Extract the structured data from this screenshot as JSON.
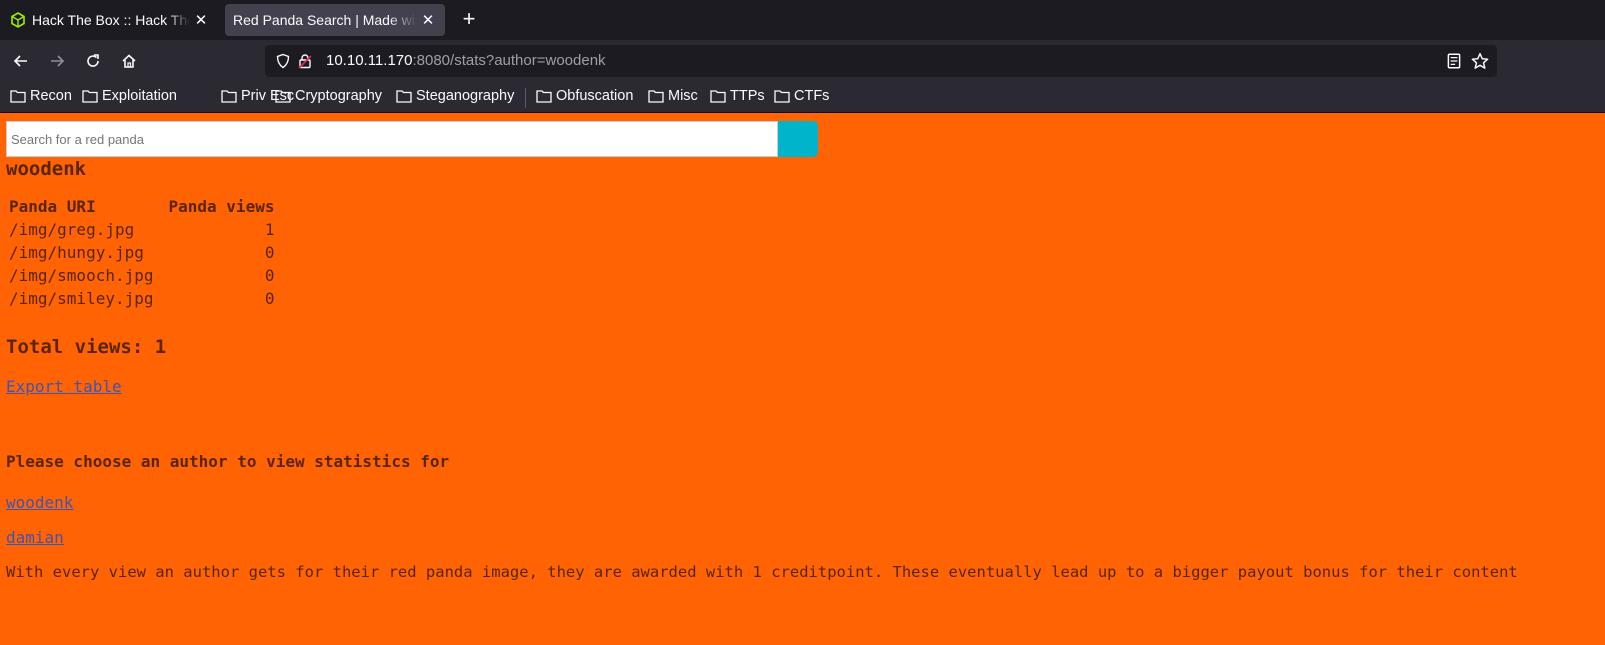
{
  "browser": {
    "tabs": [
      {
        "title": "Hack The Box :: Hack The Box",
        "icon": "htb-cube-icon",
        "active": false
      },
      {
        "title": "Red Panda Search | Made with Spring Boot",
        "active": true
      }
    ],
    "address": {
      "host": "10.10.11.170",
      "rest": ":8080/stats?author=woodenk"
    },
    "bookmarks": [
      "Recon",
      "Exploitation",
      "Priv Esc",
      "Cryptography",
      "Steganography",
      "Obfuscation",
      "Misc",
      "TTPs",
      "CTFs"
    ]
  },
  "page": {
    "search": {
      "placeholder": "Search for a red panda"
    },
    "author": "woodenk",
    "table": {
      "headers": [
        "Panda URI",
        "Panda views"
      ],
      "rows": [
        [
          "/img/greg.jpg",
          "1"
        ],
        [
          "/img/hungy.jpg",
          "0"
        ],
        [
          "/img/smooch.jpg",
          "0"
        ],
        [
          "/img/smiley.jpg",
          "0"
        ]
      ]
    },
    "total": "Total views: 1",
    "export_link": "Export table",
    "choose_heading": "Please choose an author to view statistics for",
    "authors": [
      "woodenk",
      "damian"
    ],
    "footer": "With every view an author gets for their red panda image, they are awarded with 1 creditpoint. These eventually lead up to a bigger payout bonus for their content"
  },
  "colors": {
    "page_bg": "#ff6303",
    "search_button": "#00b4cc",
    "link": "#3c55b5"
  }
}
